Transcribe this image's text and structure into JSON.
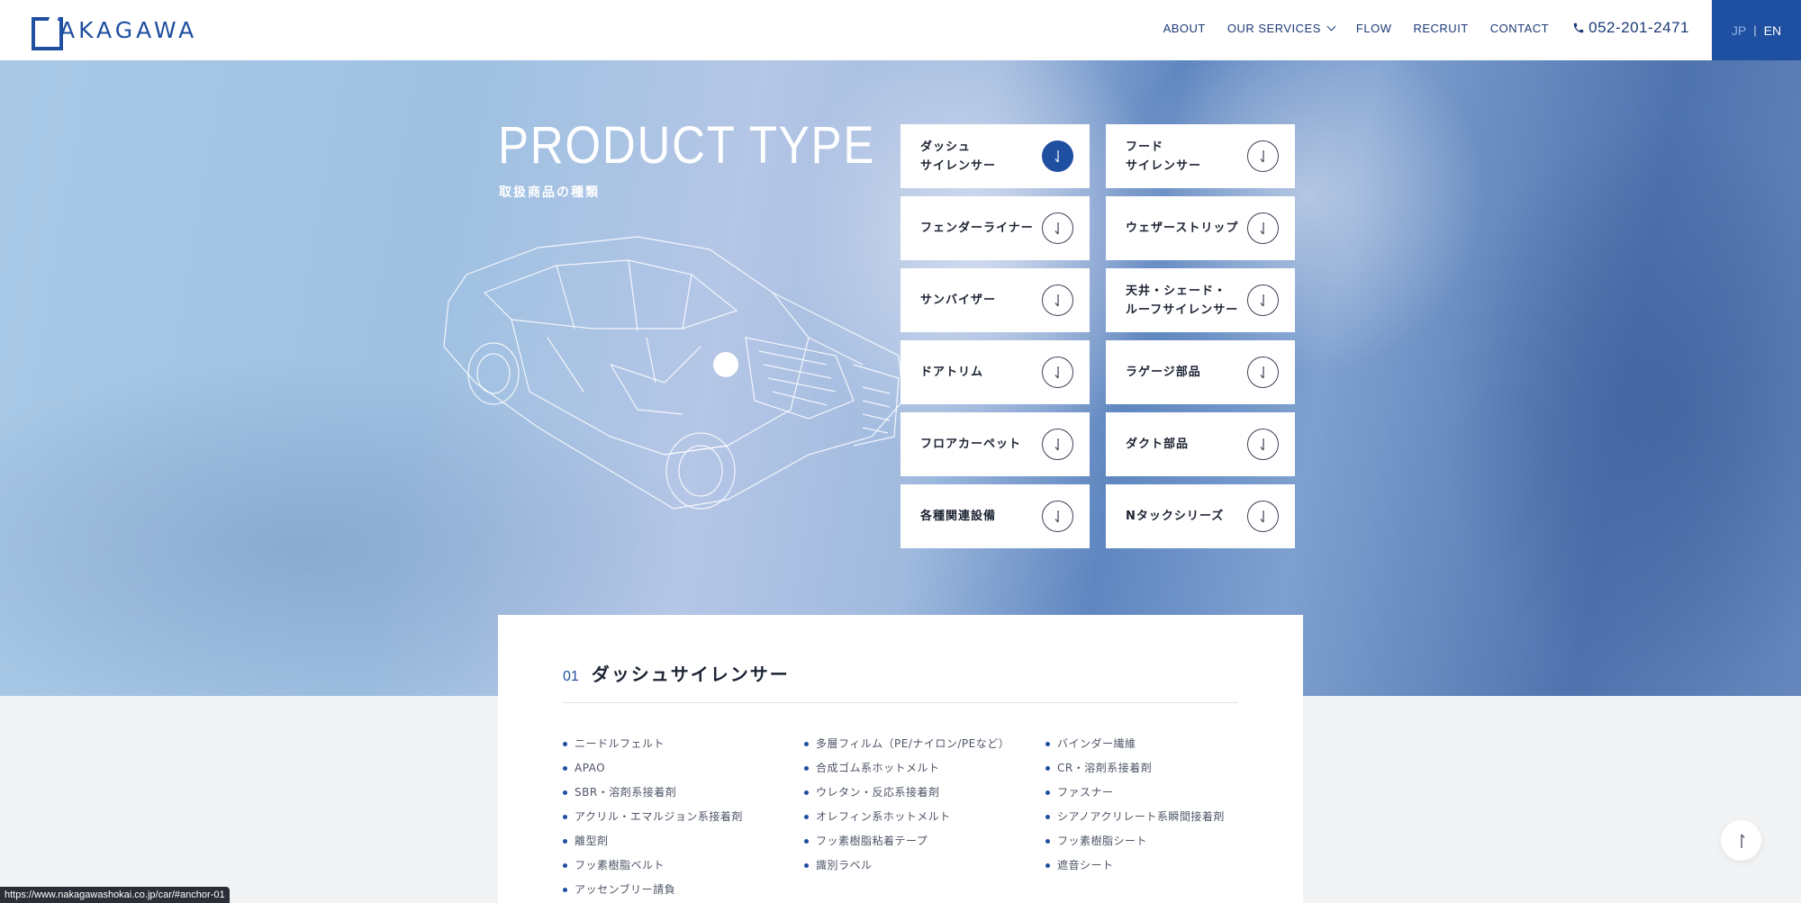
{
  "header": {
    "logo_text": "AKAGAWA",
    "nav": [
      {
        "label": "ABOUT"
      },
      {
        "label": "OUR SERVICES"
      },
      {
        "label": "FLOW"
      },
      {
        "label": "RECRUIT"
      },
      {
        "label": "CONTACT"
      }
    ],
    "phone": "052-201-2471",
    "lang": {
      "jp": "JP",
      "separator": "|",
      "en": "EN"
    }
  },
  "hero": {
    "title": "PRODUCT TYPE",
    "subtitle": "取扱商品の種類"
  },
  "products": [
    {
      "label": "ダッシュ\nサイレンサー",
      "active": true
    },
    {
      "label": "フード\nサイレンサー",
      "active": false
    },
    {
      "label": "フェンダーライナー",
      "active": false
    },
    {
      "label": "ウェザーストリップ",
      "active": false
    },
    {
      "label": "サンバイザー",
      "active": false
    },
    {
      "label": "天井・シェード・\nルーフサイレンサー",
      "active": false
    },
    {
      "label": "ドアトリム",
      "active": false
    },
    {
      "label": "ラゲージ部品",
      "active": false
    },
    {
      "label": "フロアカーペット",
      "active": false
    },
    {
      "label": "ダクト部品",
      "active": false
    },
    {
      "label": "各種関連設備",
      "active": false
    },
    {
      "label": "Nタックシリーズ",
      "active": false
    }
  ],
  "section": {
    "number": "01",
    "title": "ダッシュサイレンサー",
    "columns": [
      [
        "ニードルフェルト",
        "APAO",
        "SBR・溶剤系接着剤",
        "アクリル・エマルジョン系接着剤",
        "離型剤",
        "フッ素樹脂ベルト",
        "アッセンブリー請負"
      ],
      [
        "多層フィルム（PE/ナイロン/PEなど）",
        "合成ゴム系ホットメルト",
        "ウレタン・反応系接着剤",
        "オレフィン系ホットメルト",
        "フッ素樹脂粘着テープ",
        "識別ラベル"
      ],
      [
        "バインダー繊維",
        "CR・溶剤系接着剤",
        "ファスナー",
        "シアノアクリレート系瞬間接着剤",
        "フッ素樹脂シート",
        "遮音シート"
      ]
    ]
  },
  "status_url": "https://www.nakagawashokai.co.jp/car/#anchor-01",
  "colors": {
    "brand": "#1f4fa0",
    "text": "#1c2333"
  }
}
